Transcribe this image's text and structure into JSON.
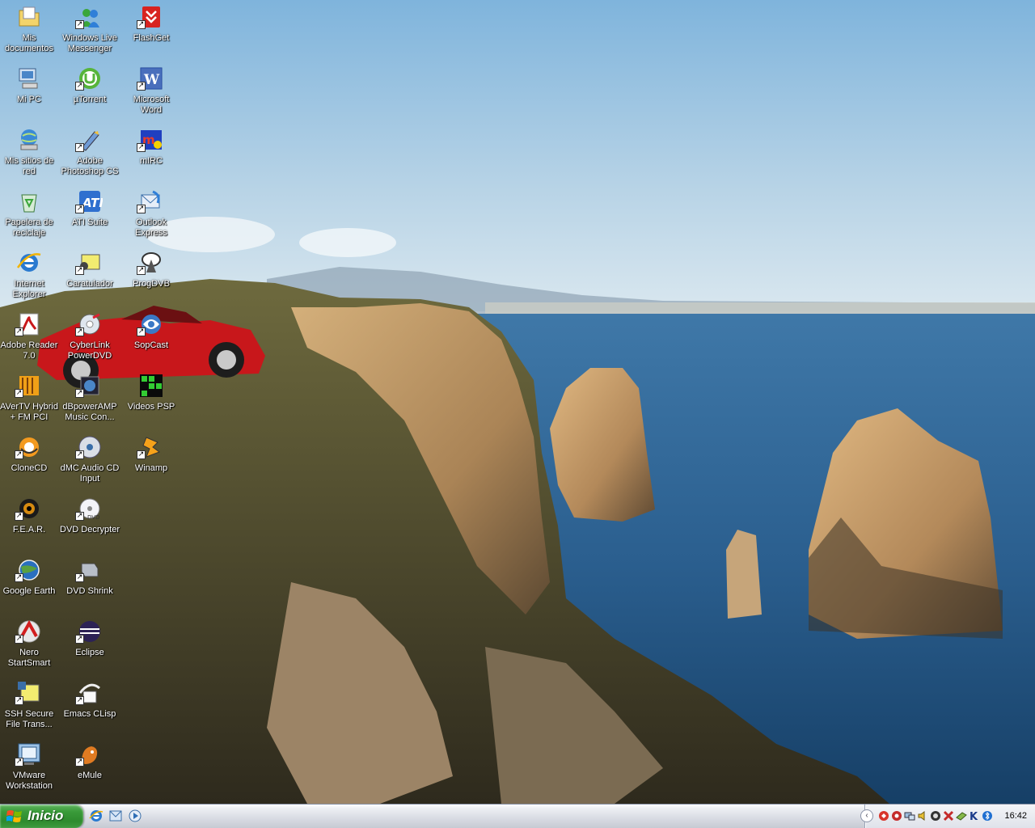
{
  "desktop": {
    "icons": [
      {
        "label": "Mis\ndocumentos",
        "icon": "my-documents-icon",
        "shortcut": false
      },
      {
        "label": "Windows Live\nMessenger",
        "icon": "messenger-icon",
        "shortcut": true
      },
      {
        "label": "FlashGet",
        "icon": "flashget-icon",
        "shortcut": true
      },
      {
        "label": "Mi PC",
        "icon": "my-computer-icon",
        "shortcut": false
      },
      {
        "label": "µTorrent",
        "icon": "utorrent-icon",
        "shortcut": true
      },
      {
        "label": "Microsoft\nWord",
        "icon": "word-icon",
        "shortcut": true
      },
      {
        "label": "Mis sitios de\nred",
        "icon": "network-places-icon",
        "shortcut": false
      },
      {
        "label": "Adobe\nPhotoshop CS",
        "icon": "photoshop-icon",
        "shortcut": true
      },
      {
        "label": "mIRC",
        "icon": "mirc-icon",
        "shortcut": true
      },
      {
        "label": "Papelera de\nreciclaje",
        "icon": "recycle-bin-icon",
        "shortcut": false
      },
      {
        "label": "ATI Suite",
        "icon": "ati-suite-icon",
        "shortcut": true
      },
      {
        "label": "Outlook\nExpress",
        "icon": "outlook-express-icon",
        "shortcut": true
      },
      {
        "label": "Internet\nExplorer",
        "icon": "internet-explorer-icon",
        "shortcut": false
      },
      {
        "label": "Caratulador",
        "icon": "caratulador-icon",
        "shortcut": true
      },
      {
        "label": "ProgDVB",
        "icon": "progdvb-icon",
        "shortcut": true
      },
      {
        "label": "Adobe Reader\n7.0",
        "icon": "adobe-reader-icon",
        "shortcut": true
      },
      {
        "label": "CyberLink\nPowerDVD",
        "icon": "powerdvd-icon",
        "shortcut": true
      },
      {
        "label": "SopCast",
        "icon": "sopcast-icon",
        "shortcut": true
      },
      {
        "label": "AVerTV Hybrid\n+ FM PCI",
        "icon": "avertv-icon",
        "shortcut": true
      },
      {
        "label": "dBpowerAMP\nMusic Con...",
        "icon": "dbpoweramp-icon",
        "shortcut": true
      },
      {
        "label": "Videos PSP",
        "icon": "videos-psp-icon",
        "shortcut": false
      },
      {
        "label": "CloneCD",
        "icon": "clonecd-icon",
        "shortcut": true
      },
      {
        "label": "dMC Audio CD\nInput",
        "icon": "dmc-audio-cd-icon",
        "shortcut": true
      },
      {
        "label": "Winamp",
        "icon": "winamp-icon",
        "shortcut": true
      },
      {
        "label": "F.E.A.R.",
        "icon": "fear-icon",
        "shortcut": true
      },
      {
        "label": "DVD Decrypter",
        "icon": "dvd-decrypter-icon",
        "shortcut": true
      },
      {
        "label": "",
        "icon": "",
        "shortcut": false
      },
      {
        "label": "Google Earth",
        "icon": "google-earth-icon",
        "shortcut": true
      },
      {
        "label": "DVD Shrink",
        "icon": "dvd-shrink-icon",
        "shortcut": true
      },
      {
        "label": "",
        "icon": "",
        "shortcut": false
      },
      {
        "label": "Nero\nStartSmart",
        "icon": "nero-icon",
        "shortcut": true
      },
      {
        "label": "Eclipse",
        "icon": "eclipse-icon",
        "shortcut": true
      },
      {
        "label": "",
        "icon": "",
        "shortcut": false
      },
      {
        "label": "SSH Secure\nFile Trans...",
        "icon": "ssh-icon",
        "shortcut": true
      },
      {
        "label": "Emacs CLisp",
        "icon": "emacs-icon",
        "shortcut": true
      },
      {
        "label": "",
        "icon": "",
        "shortcut": false
      },
      {
        "label": "VMware\nWorkstation",
        "icon": "vmware-icon",
        "shortcut": true
      },
      {
        "label": "eMule",
        "icon": "emule-icon",
        "shortcut": true
      }
    ]
  },
  "taskbar": {
    "start_label": "Inicio",
    "quick_launch": [
      "internet-explorer-icon",
      "outlook-express-icon",
      "media-player-icon"
    ],
    "tray_icons": [
      "show-hidden-icons-chevron",
      "antivirus-icon",
      "messenger-tray-icon",
      "network-icon",
      "volume-icon",
      "ati-tray-icon",
      "avertv-tray-icon",
      "usb-icon",
      "k-icon",
      "bluetooth-icon"
    ],
    "clock": "16:42"
  },
  "colors": {
    "taskbar_bg": "#d8dbe3",
    "start_green": "#3a9b3a",
    "sea": "#2b5f8f",
    "sky": "#a9cbe2"
  }
}
